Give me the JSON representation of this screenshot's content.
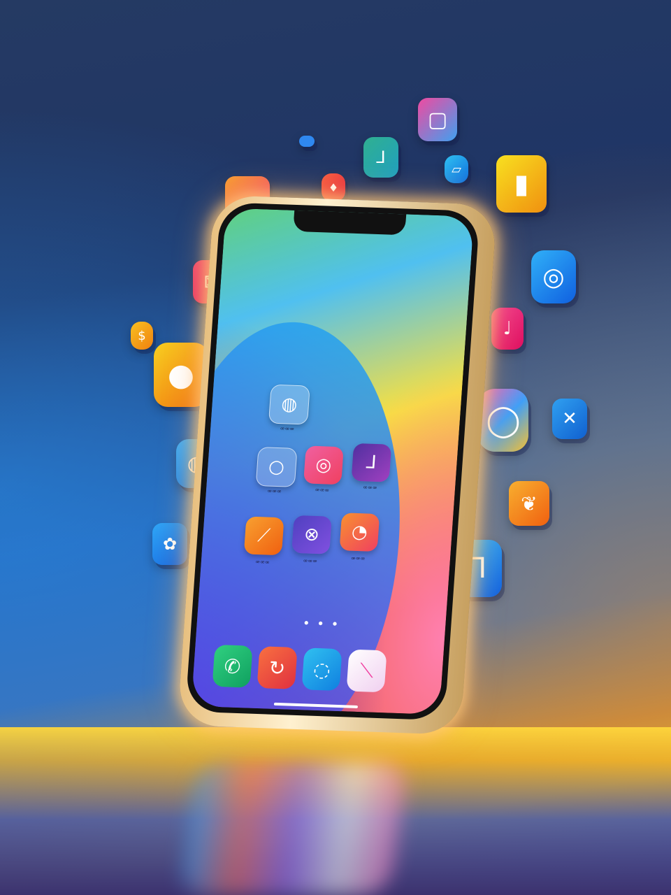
{
  "home_screen": {
    "row1": [
      {
        "label": "ꟹꟹꟹ"
      }
    ],
    "row2": [
      {
        "label": "ꟹꟹꟹ"
      },
      {
        "label": "ꟹꟹꟹ"
      },
      {
        "label": "ꟹꟹꟹ"
      }
    ],
    "row3": [
      {
        "label": "ꟹꟹꟹ"
      },
      {
        "label": "ꟹꟹꟹ"
      },
      {
        "label": "ꟹꟹꟹ"
      }
    ],
    "page_dots": "• • •"
  },
  "colors": {
    "glow": "#ffc880",
    "floor_light": "#f0c02a",
    "bg_top": "#253a63"
  },
  "icons": {
    "dock": [
      "phone-icon",
      "refresh-icon",
      "compass-icon",
      "stripe-icon"
    ],
    "floating": [
      "square-icon",
      "brush-icon",
      "chat-icon",
      "image-icon",
      "dollar-icon",
      "circle-icon",
      "target-icon",
      "note-icon",
      "ring-icon",
      "cross-icon",
      "heart-icon",
      "letter-icon",
      "basket-icon",
      "leaf-icon",
      "flower-icon",
      "tag-icon"
    ]
  }
}
